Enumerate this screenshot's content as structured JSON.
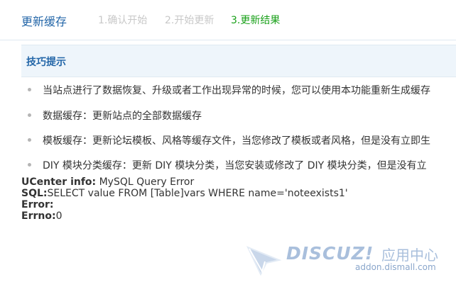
{
  "header": {
    "title": "更新缓存",
    "steps": [
      "1.确认开始",
      "2.开始更新",
      "3.更新结果"
    ]
  },
  "tips": {
    "heading": "技巧提示",
    "items": [
      "当站点进行了数据恢复、升级或者工作出现异常的时候，您可以使用本功能重新生成缓存",
      "数据缓存：更新站点的全部数据缓存",
      "模板缓存：更新论坛模板、风格等缓存文件，当您修改了模板或者风格，但是没有立即生",
      "DIY 模块分类缓存：更新 DIY 模块分类，当您安装或修改了 DIY 模块分类，但是没有立"
    ]
  },
  "error": {
    "info_label": "UCenter info:",
    "info_value": " MySQL Query Error",
    "sql_label": "SQL:",
    "sql_value": "SELECT value FROM [Table]vars WHERE name='noteexists1'",
    "error_label": "Error:",
    "error_value": "",
    "errno_label": "Errno:",
    "errno_value": "0"
  },
  "watermark": {
    "brand": "DISCUZ!",
    "brand_cn": "应用中心",
    "url": "addon.dismall.com"
  },
  "colors": {
    "title": "#2366a8",
    "active_step": "#19a019",
    "inactive_step": "#c8c8c8",
    "tips_bg": "#eef5fb",
    "watermark": "#a9bfdc"
  }
}
